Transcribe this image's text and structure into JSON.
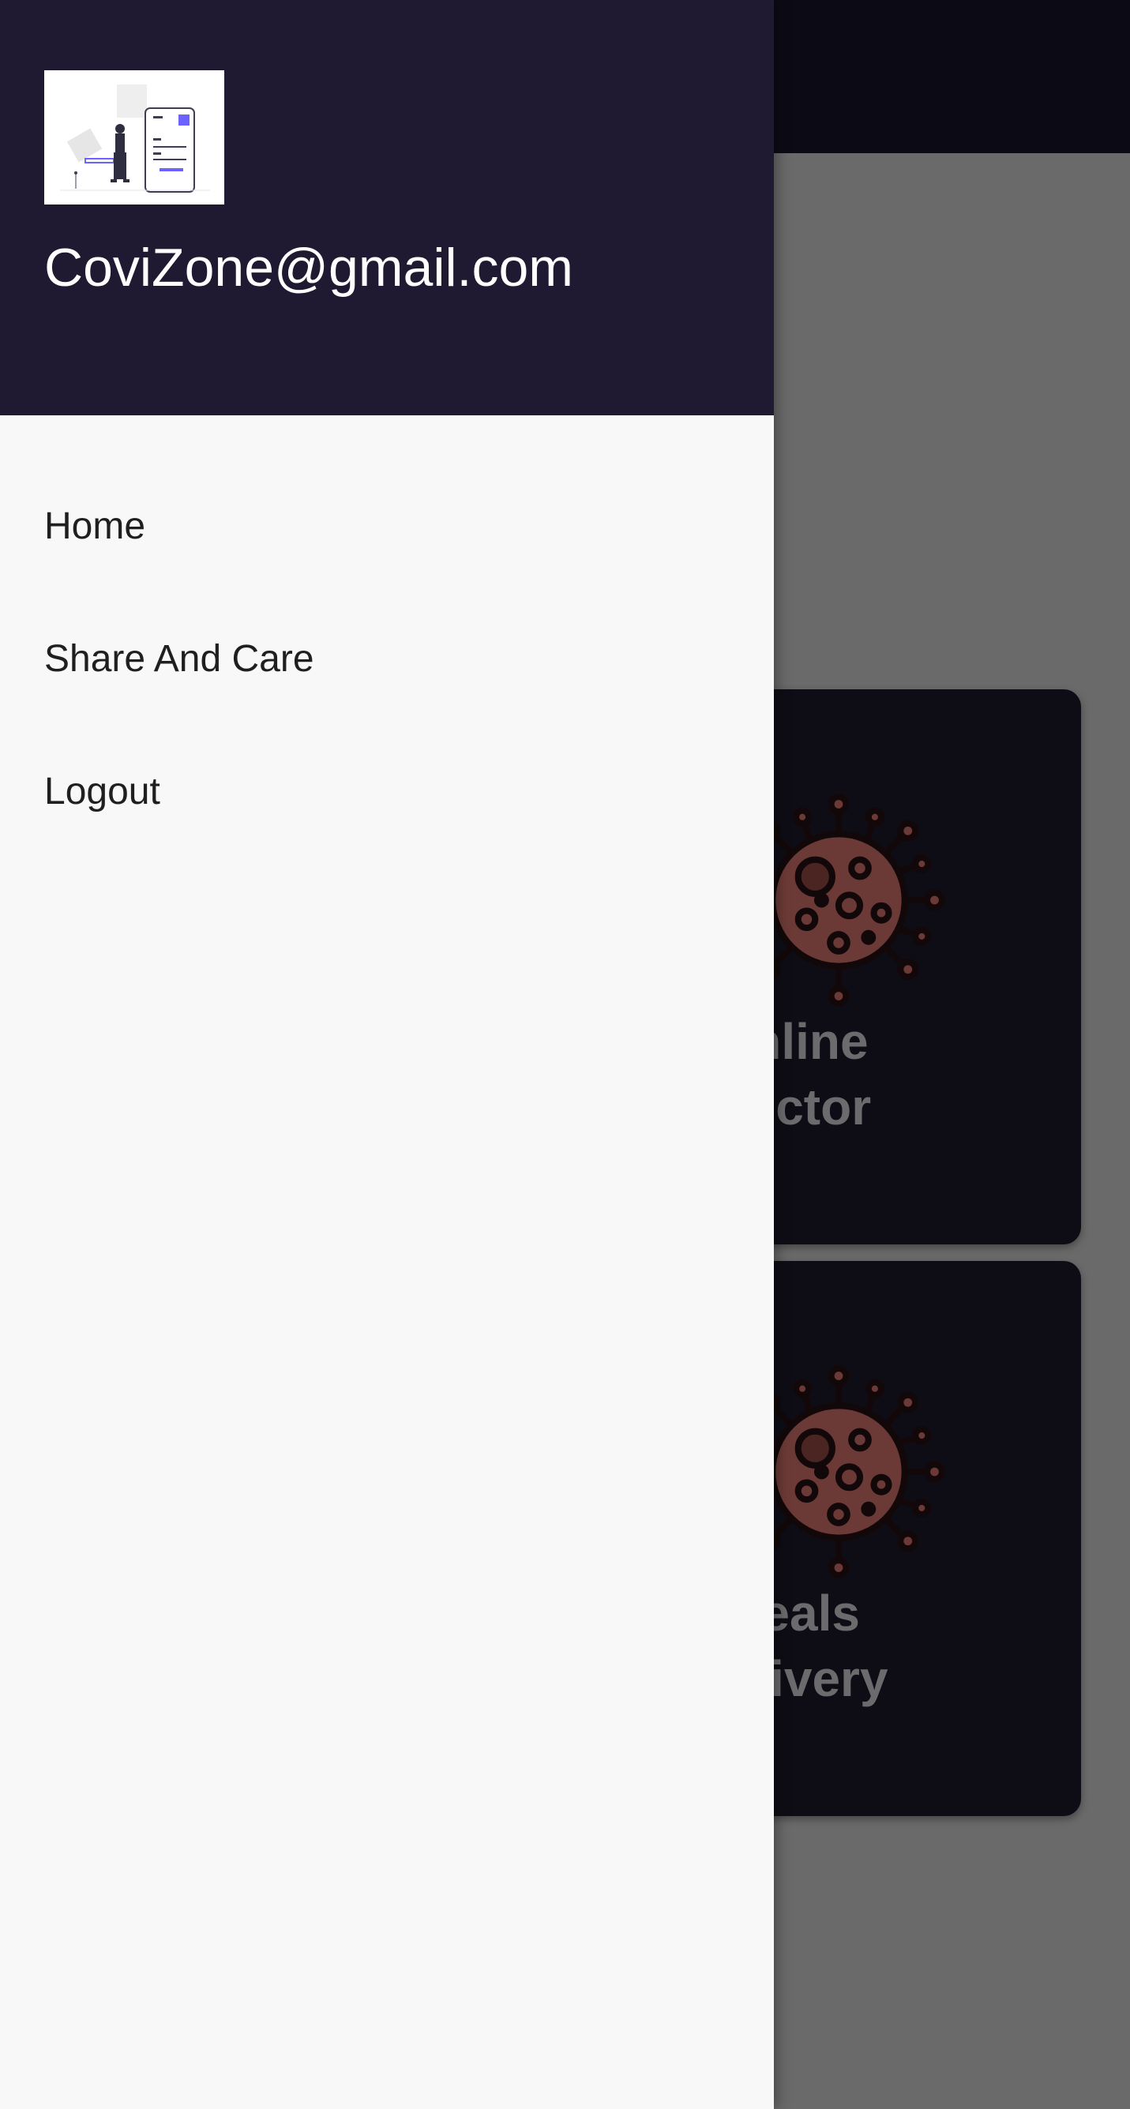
{
  "drawer": {
    "email": "CoviZone@gmail.com",
    "menu": [
      {
        "label": "Home"
      },
      {
        "label": "Share And Care"
      },
      {
        "label": "Logout"
      }
    ]
  },
  "cards": [
    {
      "line1": "Online",
      "line2": "Doctor"
    },
    {
      "line1": "Meals",
      "line2": "Delivery"
    }
  ],
  "colors": {
    "drawer_header": "#1f1a31",
    "drawer_body": "#f8f8f8",
    "scrim": "#6a6a6a",
    "card": "#0e0d16",
    "virus": "#6b3a36",
    "virus_outline": "#120809",
    "accent": "#6c63ff"
  }
}
